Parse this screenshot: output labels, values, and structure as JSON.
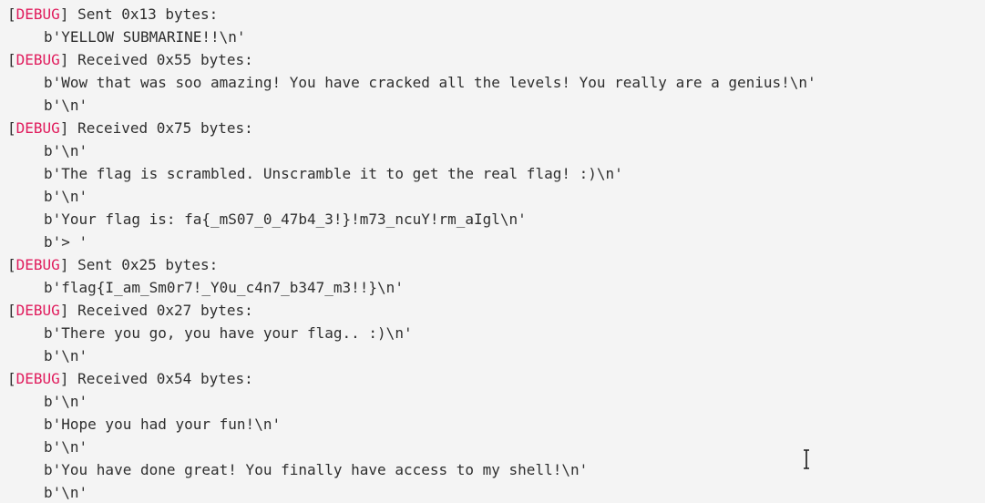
{
  "log": [
    {
      "type": "header",
      "tag": "DEBUG",
      "text": " Sent 0x13 bytes:"
    },
    {
      "type": "data",
      "text": "b'YELLOW SUBMARINE!!\\n'"
    },
    {
      "type": "header",
      "tag": "DEBUG",
      "text": " Received 0x55 bytes:"
    },
    {
      "type": "data",
      "text": "b'Wow that was soo amazing! You have cracked all the levels! You really are a genius!\\n'"
    },
    {
      "type": "data",
      "text": "b'\\n'"
    },
    {
      "type": "header",
      "tag": "DEBUG",
      "text": " Received 0x75 bytes:"
    },
    {
      "type": "data",
      "text": "b'\\n'"
    },
    {
      "type": "data",
      "text": "b'The flag is scrambled. Unscramble it to get the real flag! :)\\n'"
    },
    {
      "type": "data",
      "text": "b'\\n'"
    },
    {
      "type": "data",
      "text": "b'Your flag is: fa{_mS07_0_47b4_3!}!m73_ncuY!rm_aIgl\\n'"
    },
    {
      "type": "data",
      "text": "b'> '"
    },
    {
      "type": "header",
      "tag": "DEBUG",
      "text": " Sent 0x25 bytes:"
    },
    {
      "type": "data",
      "text": "b'flag{I_am_Sm0r7!_Y0u_c4n7_b347_m3!!}\\n'"
    },
    {
      "type": "header",
      "tag": "DEBUG",
      "text": " Received 0x27 bytes:"
    },
    {
      "type": "data",
      "text": "b'There you go, you have your flag.. :)\\n'"
    },
    {
      "type": "data",
      "text": "b'\\n'"
    },
    {
      "type": "header",
      "tag": "DEBUG",
      "text": " Received 0x54 bytes:"
    },
    {
      "type": "data",
      "text": "b'\\n'"
    },
    {
      "type": "data",
      "text": "b'Hope you had your fun!\\n'"
    },
    {
      "type": "data",
      "text": "b'\\n'"
    },
    {
      "type": "data",
      "text": "b'You have done great! You finally have access to my shell!\\n'"
    },
    {
      "type": "data",
      "text": "b'\\n'"
    }
  ],
  "colors": {
    "background": "#f4f4f4",
    "text": "#2e2e2e",
    "debug_tag": "#e01b5c"
  },
  "icons": {
    "cursor": "text-cursor-icon"
  }
}
